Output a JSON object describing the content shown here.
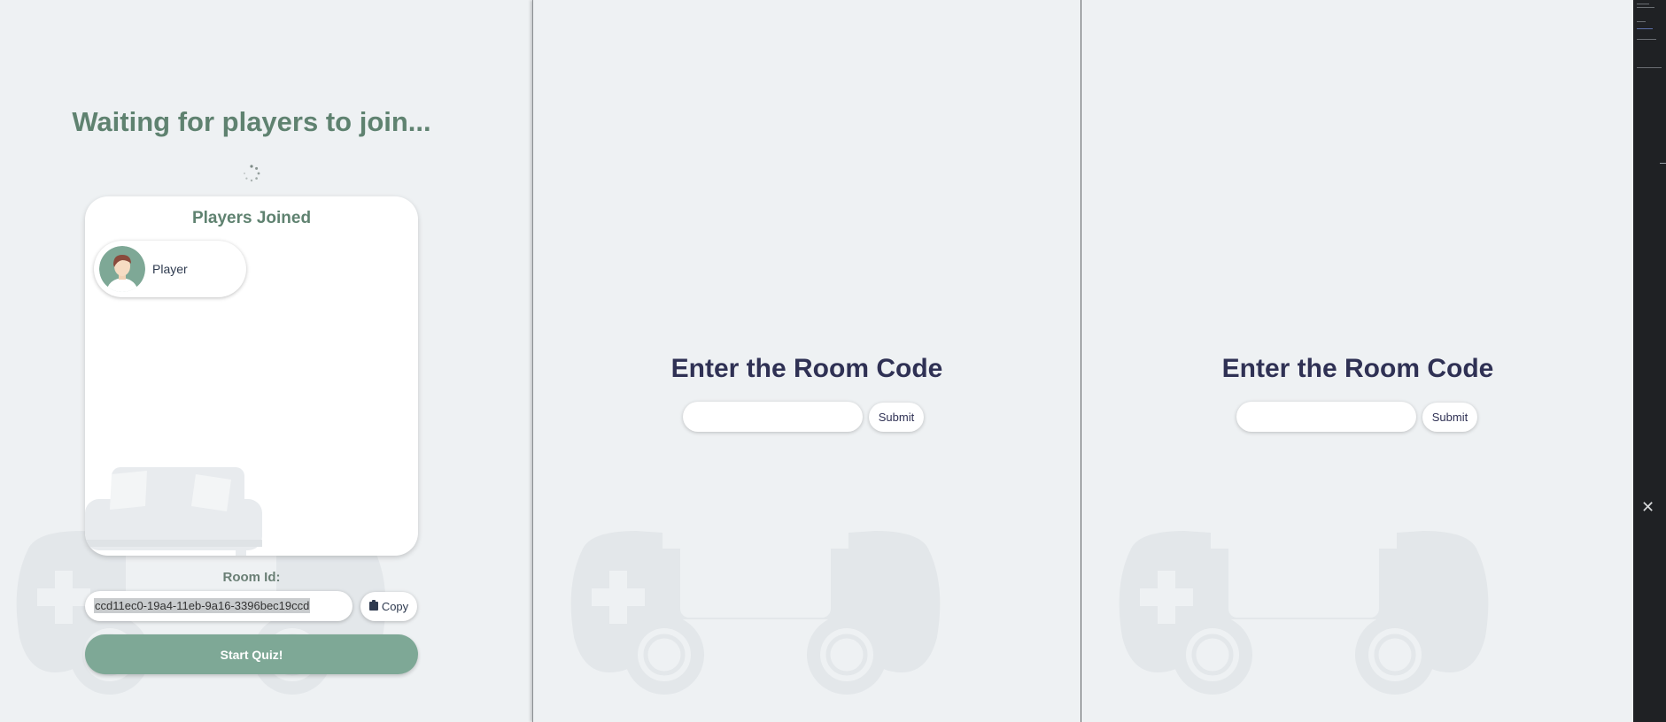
{
  "colors": {
    "background": "#eef1f3",
    "accent_green": "#7ea896",
    "title_green": "#5f8270",
    "title_navy": "#2f3154",
    "devtools_bg": "#1f2124"
  },
  "host": {
    "waiting_title": "Waiting for players to join...",
    "players_card": {
      "title": "Players Joined",
      "players": [
        {
          "name": "Player"
        }
      ]
    },
    "room": {
      "label": "Room Id:",
      "value": "ccd11ec0-19a4-11eb-9a16-3396bec19ccd",
      "copy_label": "Copy"
    },
    "start_label": "Start Quiz!"
  },
  "join_panes": [
    {
      "title": "Enter the Room Code",
      "input_value": "",
      "submit_label": "Submit"
    },
    {
      "title": "Enter the Room Code",
      "input_value": "",
      "submit_label": "Submit"
    }
  ],
  "devtools": {
    "close_icon": "close-icon"
  }
}
